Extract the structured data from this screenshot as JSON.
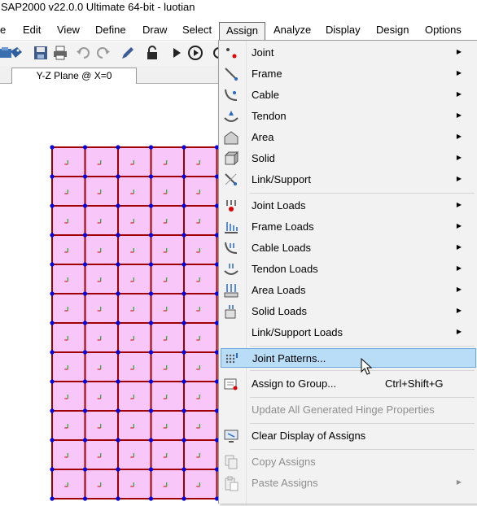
{
  "window": {
    "title": "SAP2000 v22.0.0 Ultimate 64-bit - luotian"
  },
  "menubar": {
    "items": [
      {
        "label": "e"
      },
      {
        "label": "Edit"
      },
      {
        "label": "View"
      },
      {
        "label": "Define"
      },
      {
        "label": "Draw"
      },
      {
        "label": "Select"
      },
      {
        "label": "Assign"
      },
      {
        "label": "Analyze"
      },
      {
        "label": "Display"
      },
      {
        "label": "Design"
      },
      {
        "label": "Options"
      }
    ],
    "active": "Assign"
  },
  "toolbar": {
    "buttons": [
      "open-icon",
      "save-icon",
      "print-icon",
      "undo-icon",
      "redo-icon",
      "pencil-icon",
      "lock-icon",
      "run-icon",
      "run-analysis-icon"
    ]
  },
  "view_tab": {
    "label": "Y-Z Plane @ X=0"
  },
  "model_view": {
    "shell_fill": "#f8c6f8",
    "frame_color": "#a00000",
    "joint_color": "#0000e6",
    "grid_columns": 5,
    "grid_rows": 12
  },
  "assign_menu": {
    "items": [
      {
        "label": "Joint",
        "icon": "joint-icon",
        "submenu": true,
        "enabled": true
      },
      {
        "label": "Frame",
        "icon": "frame-icon",
        "submenu": true,
        "enabled": true
      },
      {
        "label": "Cable",
        "icon": "cable-icon",
        "submenu": true,
        "enabled": true
      },
      {
        "label": "Tendon",
        "icon": "tendon-icon",
        "submenu": true,
        "enabled": true
      },
      {
        "label": "Area",
        "icon": "area-icon",
        "submenu": true,
        "enabled": true
      },
      {
        "label": "Solid",
        "icon": "solid-icon",
        "submenu": true,
        "enabled": true
      },
      {
        "label": "Link/Support",
        "icon": "link-support-icon",
        "submenu": true,
        "enabled": true
      },
      {
        "label": "Joint Loads",
        "icon": "joint-loads-icon",
        "submenu": true,
        "enabled": true
      },
      {
        "label": "Frame Loads",
        "icon": "frame-loads-icon",
        "submenu": true,
        "enabled": true
      },
      {
        "label": "Cable Loads",
        "icon": "cable-loads-icon",
        "submenu": true,
        "enabled": true
      },
      {
        "label": "Tendon Loads",
        "icon": "tendon-loads-icon",
        "submenu": true,
        "enabled": true
      },
      {
        "label": "Area Loads",
        "icon": "area-loads-icon",
        "submenu": true,
        "enabled": true
      },
      {
        "label": "Solid Loads",
        "icon": "solid-loads-icon",
        "submenu": true,
        "enabled": true
      },
      {
        "label": "Link/Support Loads",
        "icon": "link-support-loads-icon",
        "submenu": true,
        "enabled": true
      },
      {
        "label": "Joint Patterns...",
        "icon": "joint-patterns-icon",
        "submenu": false,
        "enabled": true,
        "highlighted": true
      },
      {
        "label": "Assign to Group...",
        "icon": "assign-group-icon",
        "shortcut": "Ctrl+Shift+G",
        "submenu": false,
        "enabled": true
      },
      {
        "label": "Update All Generated Hinge Properties",
        "icon": "",
        "submenu": false,
        "enabled": false
      },
      {
        "label": "Clear Display of Assigns",
        "icon": "clear-display-icon",
        "submenu": false,
        "enabled": true
      },
      {
        "label": "Copy Assigns",
        "icon": "copy-assigns-icon",
        "submenu": false,
        "enabled": false
      },
      {
        "label": "Paste Assigns",
        "icon": "paste-assigns-icon",
        "submenu": true,
        "enabled": false
      }
    ]
  }
}
